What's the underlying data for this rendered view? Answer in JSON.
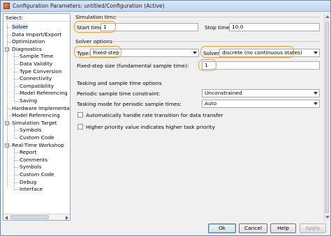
{
  "window": {
    "title": "Configuration Parameters: untitled/Configuration (Active)",
    "icon": "simulink-config-icon",
    "highlight_color": "#f0a030"
  },
  "tree": {
    "header": "Select:",
    "items": [
      {
        "label": "Solver",
        "selected": true
      },
      {
        "label": "Data Import/Export"
      },
      {
        "label": "Optimization"
      },
      {
        "label": "Diagnostics",
        "expanded": true
      },
      {
        "label": "Sample Time"
      },
      {
        "label": "Data Validity"
      },
      {
        "label": "Type Conversion"
      },
      {
        "label": "Connectivity"
      },
      {
        "label": "Compatibility"
      },
      {
        "label": "Model Referencing"
      },
      {
        "label": "Saving"
      },
      {
        "label": "Hardware Implementatio..."
      },
      {
        "label": "Model Referencing"
      },
      {
        "label": "Simulation Target",
        "expanded": true
      },
      {
        "label": "Symbols"
      },
      {
        "label": "Custom Code"
      },
      {
        "label": "Real-Time Workshop",
        "expanded": true
      },
      {
        "label": "Report"
      },
      {
        "label": "Comments"
      },
      {
        "label": "Symbols"
      },
      {
        "label": "Custom Code"
      },
      {
        "label": "Debug"
      },
      {
        "label": "Interface"
      }
    ]
  },
  "simulation_time": {
    "section": "Simulation time",
    "start_label": "Start time:",
    "start_value": "1",
    "stop_label": "Stop time:",
    "stop_value": "10.0"
  },
  "solver_options": {
    "section": "Solver options",
    "type_label": "Type:",
    "type_value": "Fixed-step",
    "solver_label": "Solver:",
    "solver_value": "discrete (no continuous states)",
    "fixed_step_label": "Fixed-step size (fundamental sample time):",
    "fixed_step_value": "1"
  },
  "tasking": {
    "section": "Tasking and sample time options",
    "periodic_label": "Periodic sample time constraint:",
    "periodic_value": "Unconstrained",
    "mode_label": "Tasking mode for periodic sample times:",
    "mode_value": "Auto",
    "auto_rate_label": "Automatically handle rate transition for data transfer",
    "auto_rate_checked": false,
    "priority_label": "Higher priority value indicates higher task priority",
    "priority_checked": false
  },
  "buttons": {
    "ok": "Ok",
    "cancel": "Cancel",
    "help": "Help",
    "apply": "Apply"
  }
}
